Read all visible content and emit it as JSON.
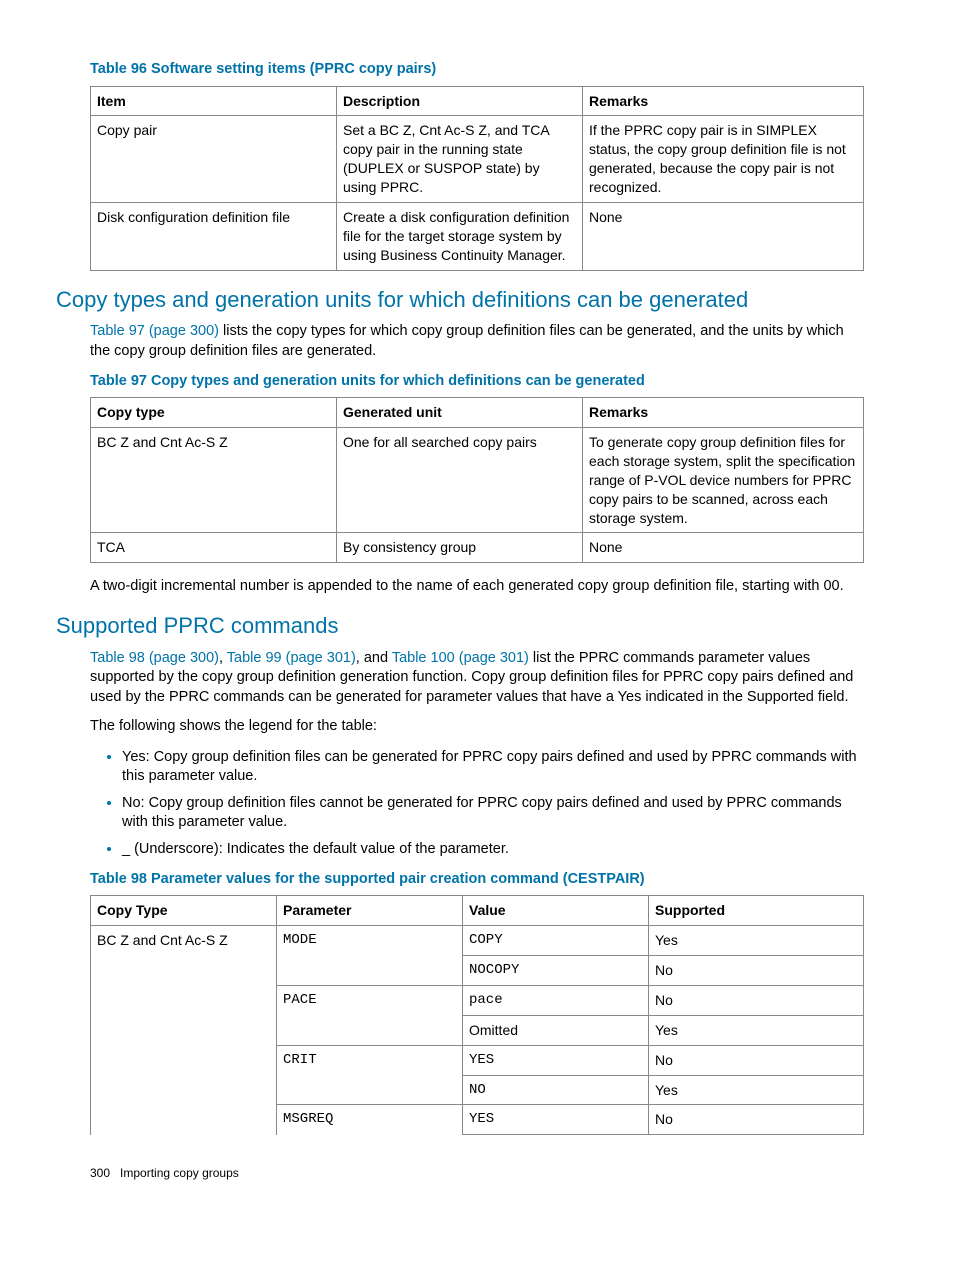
{
  "t96": {
    "caption": "Table 96 Software setting items (PPRC copy pairs)",
    "h": [
      "Item",
      "Description",
      "Remarks"
    ],
    "rows": [
      [
        "Copy pair",
        "Set a BC Z, Cnt Ac-S Z, and TCA copy pair in the running state (DUPLEX or SUSPOP state) by using PPRC.",
        "If the PPRC copy pair is in SIMPLEX status, the copy group definition file is not generated, because the copy pair is not recognized."
      ],
      [
        "Disk configuration definition file",
        "Create a disk configuration definition file for the target storage system by using Business Continuity Manager.",
        "None"
      ]
    ]
  },
  "sec1": {
    "title": "Copy types and generation units for which definitions can be generated",
    "link": "Table 97 (page 300)",
    "para_tail": " lists the copy types for which copy group definition files can be generated, and the units by which the copy group definition files are generated."
  },
  "t97": {
    "caption": "Table 97 Copy types and generation units for which definitions can be generated",
    "h": [
      "Copy type",
      "Generated unit",
      "Remarks"
    ],
    "rows": [
      [
        "BC Z and Cnt Ac-S Z",
        "One for all searched copy pairs",
        "To generate copy group definition files for each storage system, split the specification range of P-VOL device numbers for PPRC copy pairs to be scanned, across each storage system."
      ],
      [
        "TCA",
        "By consistency group",
        "None"
      ]
    ]
  },
  "note97": "A two-digit incremental number is appended to the name of each generated copy group definition file, starting with 00.",
  "sec2": {
    "title": "Supported PPRC commands",
    "links": [
      "Table 98 (page 300)",
      "Table 99 (page 301)",
      "Table 100 (page 301)"
    ],
    "para_tail": " list the PPRC commands parameter values supported by the copy group definition generation function. Copy group definition files for PPRC copy pairs defined and used by the PPRC commands can be generated for parameter values that have a Yes indicated in the Supported field.",
    "legend_intro": "The following shows the legend for the table:",
    "legend": [
      "Yes: Copy group definition files can be generated for PPRC copy pairs defined and used by PPRC commands with this parameter value.",
      "No: Copy group definition files cannot be generated for PPRC copy pairs defined and used by PPRC commands with this parameter value.",
      "_ (Underscore): Indicates the default value of the parameter."
    ]
  },
  "t98": {
    "caption": "Table 98 Parameter values for the supported pair creation command (CESTPAIR)",
    "h": [
      "Copy Type",
      "Parameter",
      "Value",
      "Supported"
    ],
    "copy_type": "BC Z and Cnt Ac-S Z",
    "params": [
      "MODE",
      "PACE",
      "CRIT",
      "MSGREQ"
    ],
    "vals": [
      "COPY",
      "NOCOPY",
      "pace",
      "Omitted",
      "YES",
      "NO",
      "YES"
    ],
    "sup": [
      "Yes",
      "No",
      "No",
      "Yes",
      "No",
      "Yes",
      "No"
    ]
  },
  "footer": {
    "page": "300",
    "section": "Importing copy groups"
  }
}
